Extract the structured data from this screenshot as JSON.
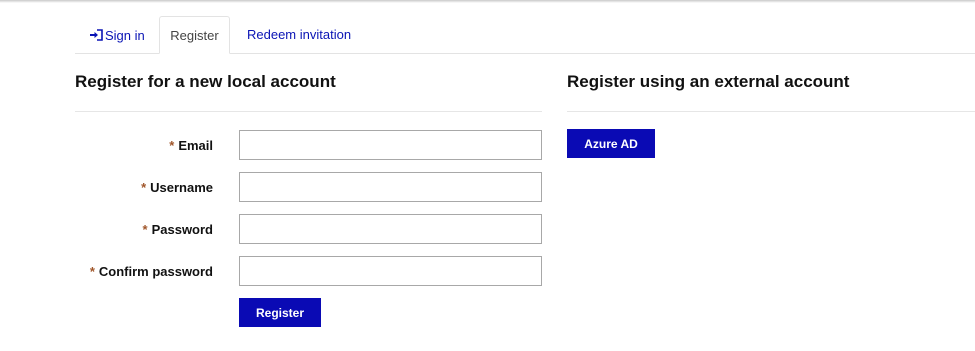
{
  "tabs": {
    "sign_in": "Sign in",
    "register": "Register",
    "redeem": "Redeem invitation"
  },
  "local": {
    "title": "Register for a new local account",
    "required_mark": "*",
    "fields": [
      {
        "label": "Email",
        "value": ""
      },
      {
        "label": "Username",
        "value": ""
      },
      {
        "label": "Password",
        "value": ""
      },
      {
        "label": "Confirm password",
        "value": ""
      }
    ],
    "submit_label": "Register"
  },
  "external": {
    "title": "Register using an external account",
    "providers": [
      "Azure AD"
    ]
  },
  "colors": {
    "accent": "#0a0ab4",
    "link": "#0a14b5",
    "required": "#a0562a"
  },
  "icons": {
    "sign_in": "sign-in-icon"
  }
}
